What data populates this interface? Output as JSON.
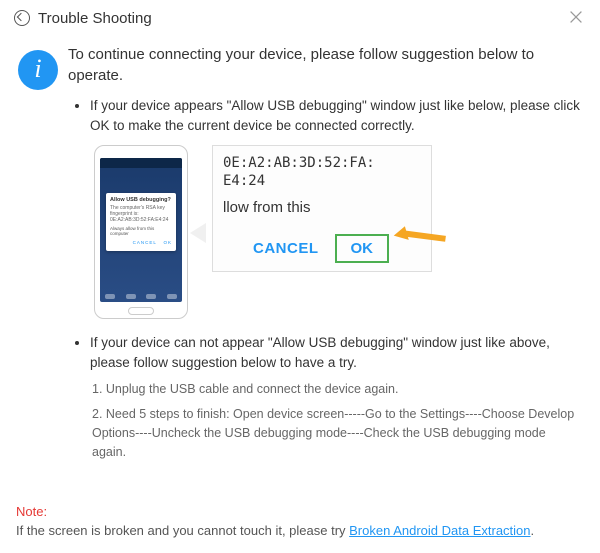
{
  "window": {
    "title": "Trouble Shooting"
  },
  "info_icon_glyph": "i",
  "lead": "To continue connecting your device, please follow suggestion below to operate.",
  "step1": {
    "text": "If your device appears \"Allow USB debugging\" window just like below, please click OK to make the current device  be connected correctly.",
    "phone_dialog_title": "Allow USB debugging?",
    "phone_dialog_body1": "The computer's RSA key fingerprint is:",
    "phone_dialog_body2": "0E:A2:AB:3D:52:FA:E4:24",
    "phone_dialog_check": "Always allow from this computer",
    "phone_dialog_cancel": "CANCEL",
    "phone_dialog_ok": "OK",
    "zoom_fp_line1": "0E:A2:AB:3D:52:FA:",
    "zoom_fp_line2": "E4:24",
    "zoom_prompt": "llow from this",
    "zoom_cancel": "CANCEL",
    "zoom_ok": "OK"
  },
  "step2": {
    "text": "If your device can not appear \"Allow USB debugging\" window just like above, please follow suggestion below to have a try.",
    "sub1": "1. Unplug the USB cable and connect the device again.",
    "sub2": "2. Need 5 steps to finish: Open device screen-----Go to the Settings----Choose Develop Options----Uncheck the USB debugging mode----Check the USB debugging mode again."
  },
  "note": {
    "label": "Note:",
    "text_before": "If the screen is broken and you cannot touch it, please try ",
    "link": "Broken Android Data Extraction",
    "text_after": "."
  }
}
